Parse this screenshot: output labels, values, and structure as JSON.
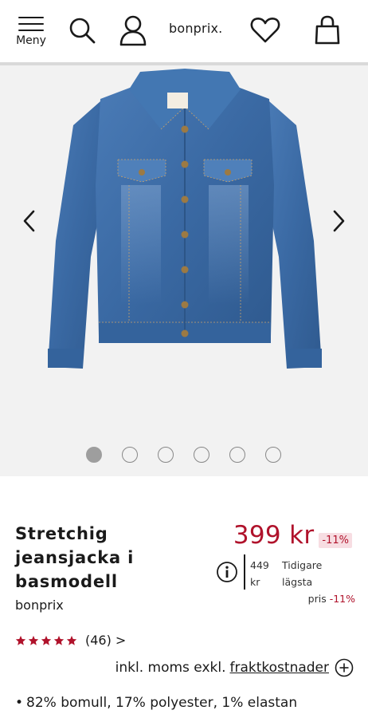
{
  "header": {
    "menu_label": "Meny",
    "logo": "bonprix."
  },
  "gallery": {
    "image_count": 6,
    "active_index": 0
  },
  "product": {
    "title_lines": [
      "Stretchig",
      "jeansjacka i",
      "basmodell"
    ],
    "brand": "bonprix",
    "price": "399 kr",
    "discount_badge": "-11%",
    "previous_price": "449 kr",
    "previous_price_label_1": "Tidigare lägsta",
    "previous_price_label_2": "pris",
    "previous_discount": "-11%",
    "rating_stars": 5,
    "review_count": "(46) >",
    "tax_text": "inkl. moms exkl.",
    "shipping_link": "fraktkostnader",
    "material": "82% bomull, 17% polyester, 1% elastan",
    "material_bullet": "•"
  },
  "colors": {
    "price_red": "#b0122b",
    "badge_bg": "#f7dde2",
    "gallery_bg": "#f2f2f2",
    "denim": "#3f6ea6"
  }
}
